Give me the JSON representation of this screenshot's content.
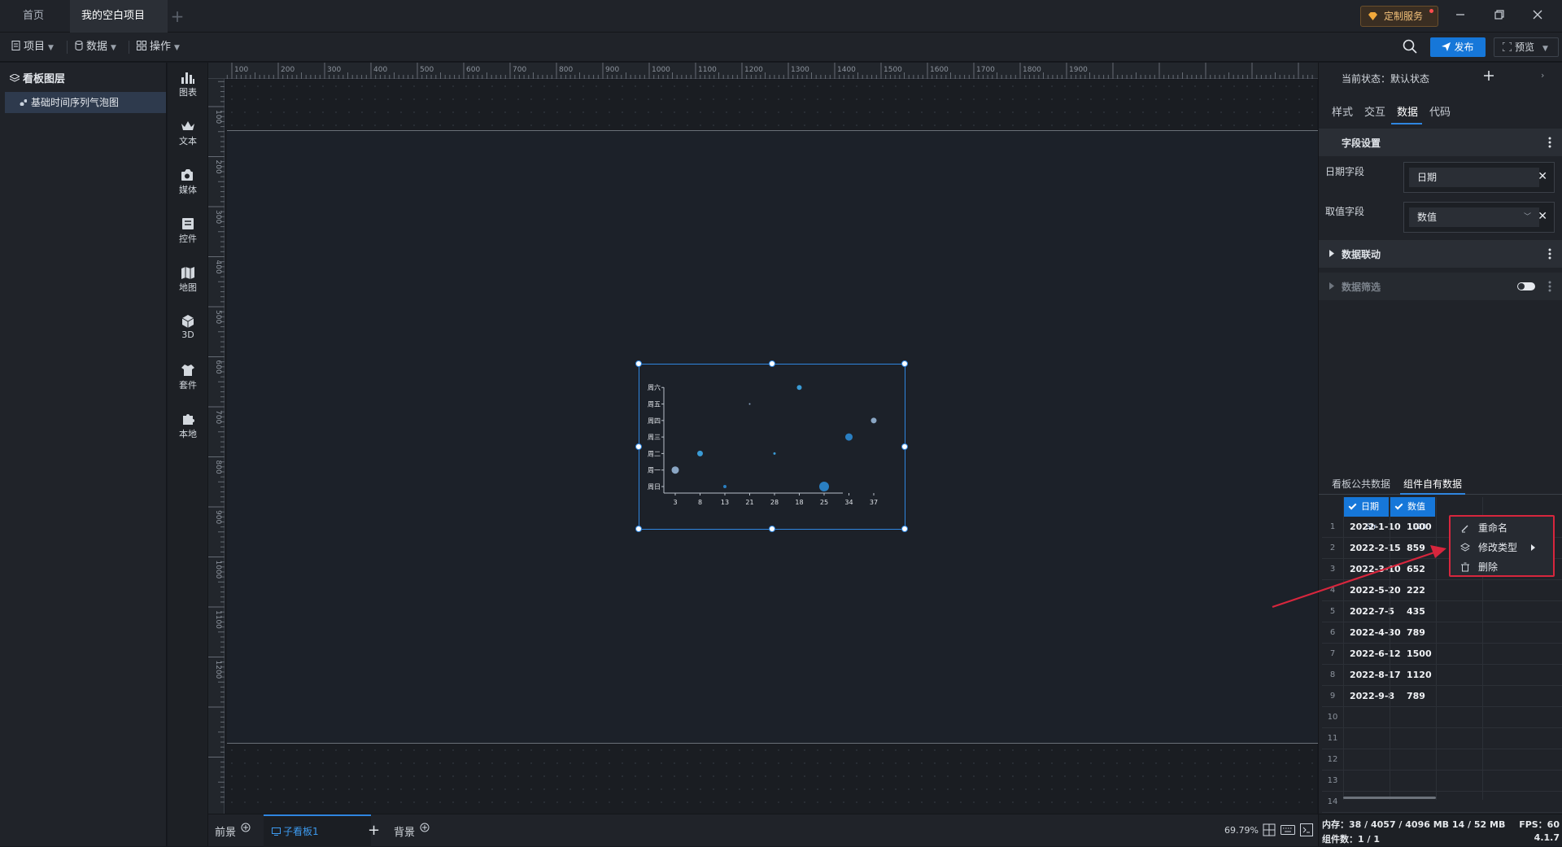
{
  "tabs": {
    "home": "首页",
    "project": "我的空白项目"
  },
  "header": {
    "custom_service": "定制服务"
  },
  "toolbar": {
    "project": "项目",
    "data": "数据",
    "operate": "操作",
    "publish": "发布",
    "preview": "预览"
  },
  "layers": {
    "title": "看板图层",
    "items": [
      "基础时间序列气泡图"
    ]
  },
  "components": [
    "图表",
    "文本",
    "媒体",
    "控件",
    "地图",
    "3D",
    "套件",
    "本地"
  ],
  "ruler_top": [
    "100",
    "200",
    "300",
    "400",
    "500",
    "600",
    "700",
    "800",
    "900",
    "1000",
    "1100",
    "1200",
    "1300",
    "1400",
    "1500",
    "1600",
    "1700",
    "1800",
    "1900"
  ],
  "ruler_left": [
    "100",
    "200",
    "300",
    "400",
    "500",
    "600",
    "700",
    "800",
    "900",
    "1000",
    "1100",
    "1200"
  ],
  "chart_data": {
    "type": "scatter",
    "title": "",
    "x_ticks": [
      "3",
      "8",
      "13",
      "21",
      "28",
      "18",
      "25",
      "34",
      "37"
    ],
    "y_ticks": [
      "周日",
      "周一",
      "周二",
      "周三",
      "周四",
      "周五",
      "周六"
    ],
    "points": [
      {
        "x_index": 0,
        "y": 1,
        "size": 9,
        "color": "#8aa6c4"
      },
      {
        "x_index": 1,
        "y": 2,
        "size": 7,
        "color": "#3a9bd5"
      },
      {
        "x_index": 2,
        "y": 0,
        "size": 4,
        "color": "#2a7fc2"
      },
      {
        "x_index": 3,
        "y": 5,
        "size": 2,
        "color": "#8aa6c4"
      },
      {
        "x_index": 4,
        "y": 2,
        "size": 3,
        "color": "#3a9bd5"
      },
      {
        "x_index": 5,
        "y": 6,
        "size": 6,
        "color": "#3a9bd5"
      },
      {
        "x_index": 6,
        "y": 0,
        "size": 12,
        "color": "#2a7fc2"
      },
      {
        "x_index": 7,
        "y": 3,
        "size": 9,
        "color": "#2a7fc2"
      },
      {
        "x_index": 8,
        "y": 4,
        "size": 7,
        "color": "#8aa6c4"
      }
    ]
  },
  "bottom": {
    "foreground": "前景",
    "subboard": "子看板1",
    "background": "背景",
    "zoom": "69.79%"
  },
  "right": {
    "state_label": "当前状态：默认状态",
    "tabs": [
      "样式",
      "交互",
      "数据",
      "代码"
    ],
    "field_settings": "字段设置",
    "date_field_label": "日期字段",
    "date_field_value": "日期",
    "value_field_label": "取值字段",
    "value_field_value": "数值",
    "data_linkage": "数据联动",
    "data_filter": "数据筛选",
    "data_tabs": [
      "看板公共数据",
      "组件自有数据"
    ],
    "table": {
      "columns": [
        {
          "name": "日期",
          "type": "Str"
        },
        {
          "name": "数值",
          "type": "123"
        }
      ],
      "rows": [
        [
          "2022-1-10",
          "1000"
        ],
        [
          "2022-2-15",
          "859"
        ],
        [
          "2022-3-10",
          "652"
        ],
        [
          "2022-5-20",
          "222"
        ],
        [
          "2022-7-5",
          "435"
        ],
        [
          "2022-4-30",
          "789"
        ],
        [
          "2022-6-12",
          "1500"
        ],
        [
          "2022-8-17",
          "1120"
        ],
        [
          "2022-9-8",
          "789"
        ]
      ],
      "row_numbers": [
        "1",
        "2",
        "3",
        "4",
        "5",
        "6",
        "7",
        "8",
        "9",
        "10",
        "11",
        "12",
        "13",
        "14"
      ]
    },
    "context_menu": [
      "重命名",
      "修改类型",
      "删除"
    ],
    "status": {
      "memory": "内存：38 / 4057 / 4096 MB 14 / 52 MB",
      "fps": "FPS：60",
      "components": "组件数：1 / 1",
      "version": "4.1.7"
    }
  },
  "colors": {
    "accent": "#1677d9",
    "annotation": "#d7263d"
  }
}
